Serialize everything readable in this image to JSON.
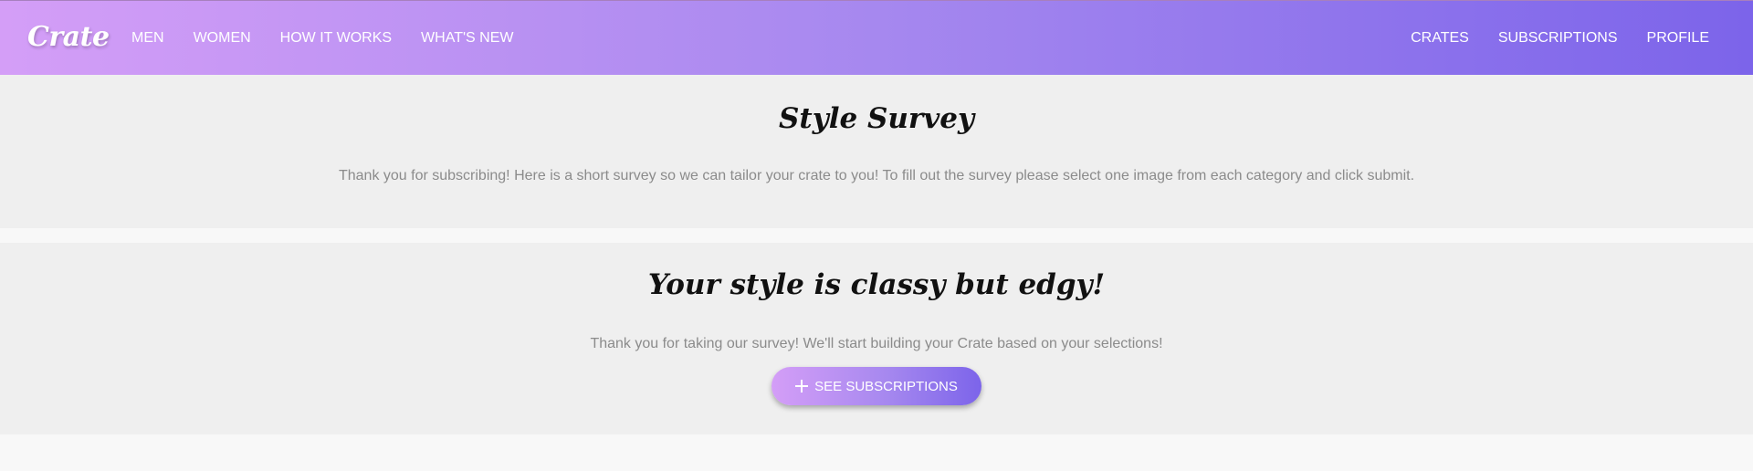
{
  "navbar": {
    "brand": "Crate",
    "left_links": [
      "MEN",
      "WOMEN",
      "HOW IT WORKS",
      "WHAT'S NEW"
    ],
    "right_links": [
      "CRATES",
      "SUBSCRIPTIONS",
      "PROFILE"
    ],
    "gradient": [
      "#d49ef7",
      "#a688ef",
      "#7c64ea"
    ]
  },
  "survey_intro": {
    "title": "Style Survey",
    "description": "Thank you for subscribing! Here is a short survey so we can tailor your crate to you! To fill out the survey please select one image from each category and click submit."
  },
  "result": {
    "title": "Your style is classy but edgy!",
    "description": "Thank you for taking our survey! We'll start building your Crate based on your selections!",
    "button_icon": "plus-icon",
    "button_label": "SEE SUBSCRIPTIONS"
  }
}
